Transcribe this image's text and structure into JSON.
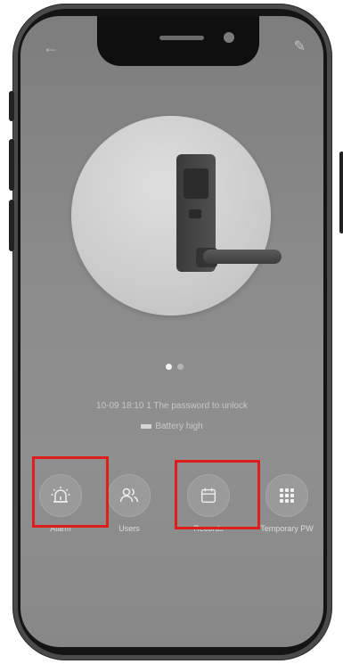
{
  "status": {
    "last_event": "10-09 18:10 1 The password to unlock",
    "battery": "Battery high"
  },
  "pager": {
    "total": 2,
    "active": 0
  },
  "actions": [
    {
      "label": "Alarm",
      "icon": "alarm-icon",
      "highlighted": true
    },
    {
      "label": "Users",
      "icon": "users-icon",
      "highlighted": false
    },
    {
      "label": "Records",
      "icon": "calendar-icon",
      "highlighted": true
    },
    {
      "label": "Temporary PW",
      "icon": "grid-icon",
      "highlighted": false
    }
  ],
  "colors": {
    "highlight": "#e01d1d",
    "screen_bg": "#8b8b8b",
    "frame": "#141414"
  }
}
